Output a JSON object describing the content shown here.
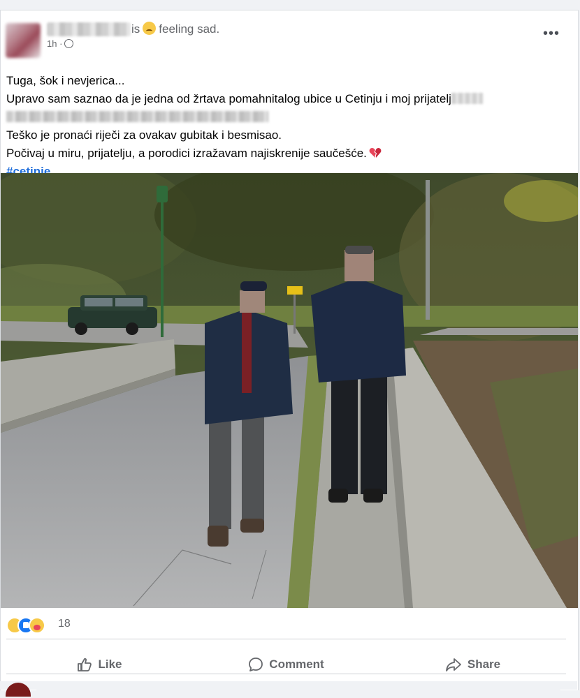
{
  "post": {
    "status_is": "is",
    "status_emoji": "sad-face-emoji",
    "status_feeling": "feeling sad.",
    "time": "1h ·",
    "menu_label": "•••",
    "lines": [
      "Tuga, šok i nevjerica...",
      "Upravo sam saznao da je jedna od žrtava pomahnitalog ubice u Cetinju i moj prijatelj",
      "Teško je pronaći riječi za ovakav gubitak i besmisao.",
      "Počivaj u miru, prijatelju, a porodici izražavam najiskrenije saučešće."
    ],
    "hashtag": "#cetinje"
  },
  "reactions": {
    "icons": [
      "sad-reaction-icon",
      "like-reaction-icon",
      "care-reaction-icon"
    ],
    "count": "18"
  },
  "actions": {
    "like": "Like",
    "comment": "Comment",
    "share": "Share"
  },
  "colors": {
    "accent": "#216fdb",
    "muted": "#65676b",
    "like_blue": "#1877f2",
    "heart_red": "#e8455a"
  }
}
